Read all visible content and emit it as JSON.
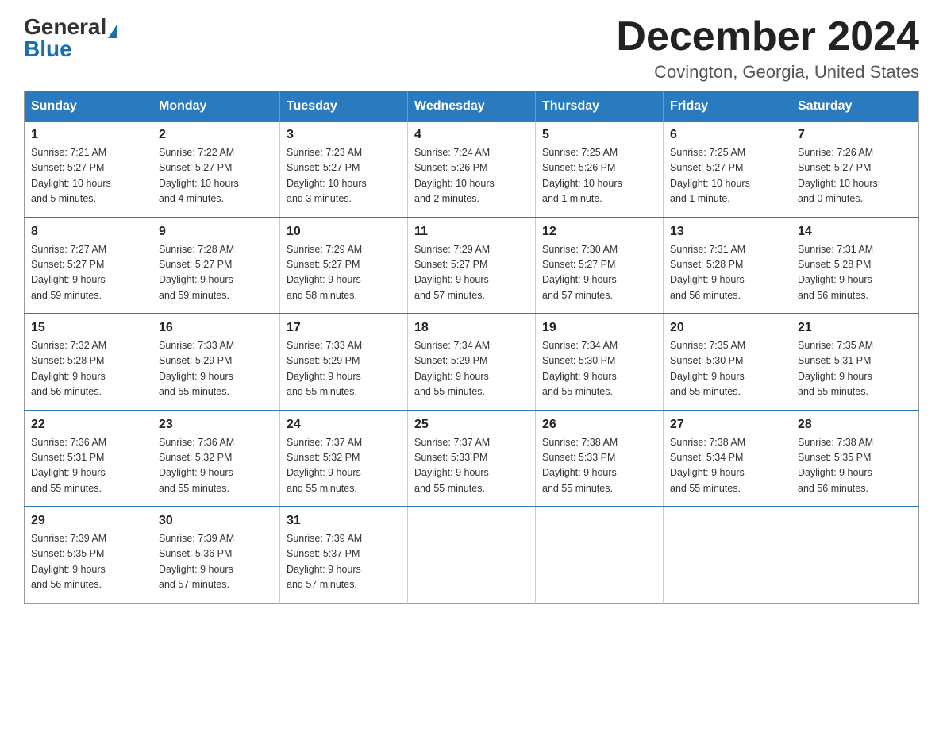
{
  "header": {
    "logo_general": "General",
    "logo_blue": "Blue",
    "month_title": "December 2024",
    "location": "Covington, Georgia, United States"
  },
  "days_of_week": [
    "Sunday",
    "Monday",
    "Tuesday",
    "Wednesday",
    "Thursday",
    "Friday",
    "Saturday"
  ],
  "weeks": [
    [
      {
        "day": "1",
        "sunrise": "7:21 AM",
        "sunset": "5:27 PM",
        "daylight": "10 hours and 5 minutes."
      },
      {
        "day": "2",
        "sunrise": "7:22 AM",
        "sunset": "5:27 PM",
        "daylight": "10 hours and 4 minutes."
      },
      {
        "day": "3",
        "sunrise": "7:23 AM",
        "sunset": "5:27 PM",
        "daylight": "10 hours and 3 minutes."
      },
      {
        "day": "4",
        "sunrise": "7:24 AM",
        "sunset": "5:26 PM",
        "daylight": "10 hours and 2 minutes."
      },
      {
        "day": "5",
        "sunrise": "7:25 AM",
        "sunset": "5:26 PM",
        "daylight": "10 hours and 1 minute."
      },
      {
        "day": "6",
        "sunrise": "7:25 AM",
        "sunset": "5:27 PM",
        "daylight": "10 hours and 1 minute."
      },
      {
        "day": "7",
        "sunrise": "7:26 AM",
        "sunset": "5:27 PM",
        "daylight": "10 hours and 0 minutes."
      }
    ],
    [
      {
        "day": "8",
        "sunrise": "7:27 AM",
        "sunset": "5:27 PM",
        "daylight": "9 hours and 59 minutes."
      },
      {
        "day": "9",
        "sunrise": "7:28 AM",
        "sunset": "5:27 PM",
        "daylight": "9 hours and 59 minutes."
      },
      {
        "day": "10",
        "sunrise": "7:29 AM",
        "sunset": "5:27 PM",
        "daylight": "9 hours and 58 minutes."
      },
      {
        "day": "11",
        "sunrise": "7:29 AM",
        "sunset": "5:27 PM",
        "daylight": "9 hours and 57 minutes."
      },
      {
        "day": "12",
        "sunrise": "7:30 AM",
        "sunset": "5:27 PM",
        "daylight": "9 hours and 57 minutes."
      },
      {
        "day": "13",
        "sunrise": "7:31 AM",
        "sunset": "5:28 PM",
        "daylight": "9 hours and 56 minutes."
      },
      {
        "day": "14",
        "sunrise": "7:31 AM",
        "sunset": "5:28 PM",
        "daylight": "9 hours and 56 minutes."
      }
    ],
    [
      {
        "day": "15",
        "sunrise": "7:32 AM",
        "sunset": "5:28 PM",
        "daylight": "9 hours and 56 minutes."
      },
      {
        "day": "16",
        "sunrise": "7:33 AM",
        "sunset": "5:29 PM",
        "daylight": "9 hours and 55 minutes."
      },
      {
        "day": "17",
        "sunrise": "7:33 AM",
        "sunset": "5:29 PM",
        "daylight": "9 hours and 55 minutes."
      },
      {
        "day": "18",
        "sunrise": "7:34 AM",
        "sunset": "5:29 PM",
        "daylight": "9 hours and 55 minutes."
      },
      {
        "day": "19",
        "sunrise": "7:34 AM",
        "sunset": "5:30 PM",
        "daylight": "9 hours and 55 minutes."
      },
      {
        "day": "20",
        "sunrise": "7:35 AM",
        "sunset": "5:30 PM",
        "daylight": "9 hours and 55 minutes."
      },
      {
        "day": "21",
        "sunrise": "7:35 AM",
        "sunset": "5:31 PM",
        "daylight": "9 hours and 55 minutes."
      }
    ],
    [
      {
        "day": "22",
        "sunrise": "7:36 AM",
        "sunset": "5:31 PM",
        "daylight": "9 hours and 55 minutes."
      },
      {
        "day": "23",
        "sunrise": "7:36 AM",
        "sunset": "5:32 PM",
        "daylight": "9 hours and 55 minutes."
      },
      {
        "day": "24",
        "sunrise": "7:37 AM",
        "sunset": "5:32 PM",
        "daylight": "9 hours and 55 minutes."
      },
      {
        "day": "25",
        "sunrise": "7:37 AM",
        "sunset": "5:33 PM",
        "daylight": "9 hours and 55 minutes."
      },
      {
        "day": "26",
        "sunrise": "7:38 AM",
        "sunset": "5:33 PM",
        "daylight": "9 hours and 55 minutes."
      },
      {
        "day": "27",
        "sunrise": "7:38 AM",
        "sunset": "5:34 PM",
        "daylight": "9 hours and 55 minutes."
      },
      {
        "day": "28",
        "sunrise": "7:38 AM",
        "sunset": "5:35 PM",
        "daylight": "9 hours and 56 minutes."
      }
    ],
    [
      {
        "day": "29",
        "sunrise": "7:39 AM",
        "sunset": "5:35 PM",
        "daylight": "9 hours and 56 minutes."
      },
      {
        "day": "30",
        "sunrise": "7:39 AM",
        "sunset": "5:36 PM",
        "daylight": "9 hours and 57 minutes."
      },
      {
        "day": "31",
        "sunrise": "7:39 AM",
        "sunset": "5:37 PM",
        "daylight": "9 hours and 57 minutes."
      },
      null,
      null,
      null,
      null
    ]
  ],
  "labels": {
    "sunrise": "Sunrise:",
    "sunset": "Sunset:",
    "daylight": "Daylight:"
  }
}
